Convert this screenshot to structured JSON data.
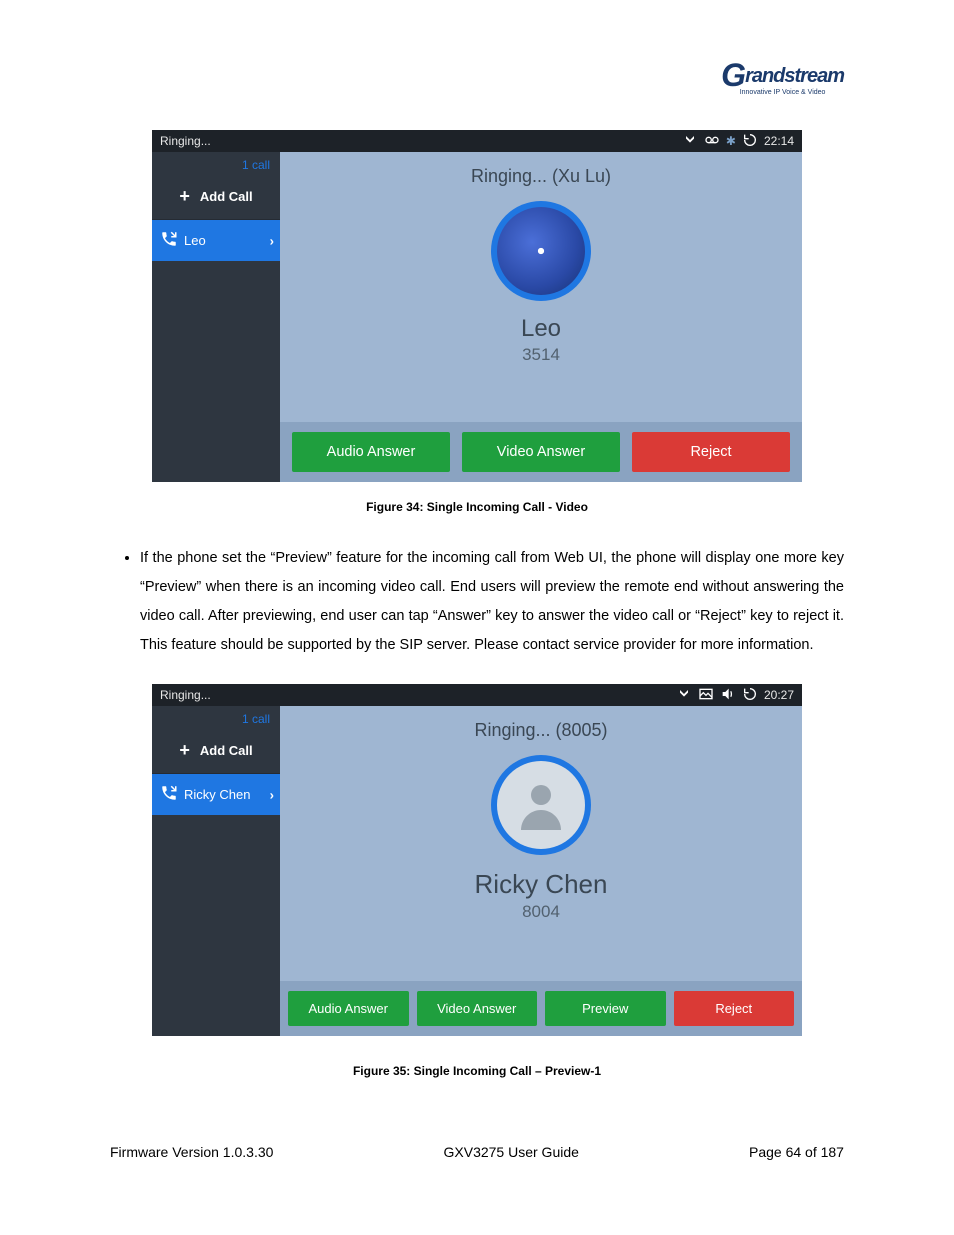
{
  "logo": {
    "brand": "Grandstream",
    "sub": "Innovative IP Voice & Video"
  },
  "figure1": {
    "caption": "Figure 34: Single Incoming Call - Video",
    "statusbar": {
      "title": "Ringing...",
      "time": "22:14"
    },
    "sidebar": {
      "count": "1 call",
      "addcall": "Add Call",
      "caller": "Leo"
    },
    "main": {
      "ringing": "Ringing... (Xu Lu)",
      "name": "Leo",
      "number": "3514",
      "buttons": {
        "audio": "Audio Answer",
        "video": "Video Answer",
        "reject": "Reject"
      }
    }
  },
  "bullet": "If the phone set the “Preview” feature for the incoming call from Web UI, the phone will display one more key “Preview” when there is an incoming video call. End users will preview the remote end without answering the video call. After previewing, end user can tap “Answer” key to answer the video call or “Reject” key to reject it. This feature should be supported by the SIP server. Please contact service provider for more information.",
  "figure2": {
    "caption": "Figure 35: Single Incoming Call – Preview-1",
    "statusbar": {
      "title": "Ringing...",
      "time": "20:27"
    },
    "sidebar": {
      "count": "1 call",
      "addcall": "Add Call",
      "caller": "Ricky Chen"
    },
    "main": {
      "ringing": "Ringing... (8005)",
      "name": "Ricky Chen",
      "number": "8004",
      "buttons": {
        "audio": "Audio Answer",
        "video": "Video Answer",
        "preview": "Preview",
        "reject": "Reject"
      }
    }
  },
  "footer": {
    "left": "Firmware Version 1.0.3.30",
    "center": "GXV3275 User Guide",
    "right": "Page 64 of 187"
  }
}
